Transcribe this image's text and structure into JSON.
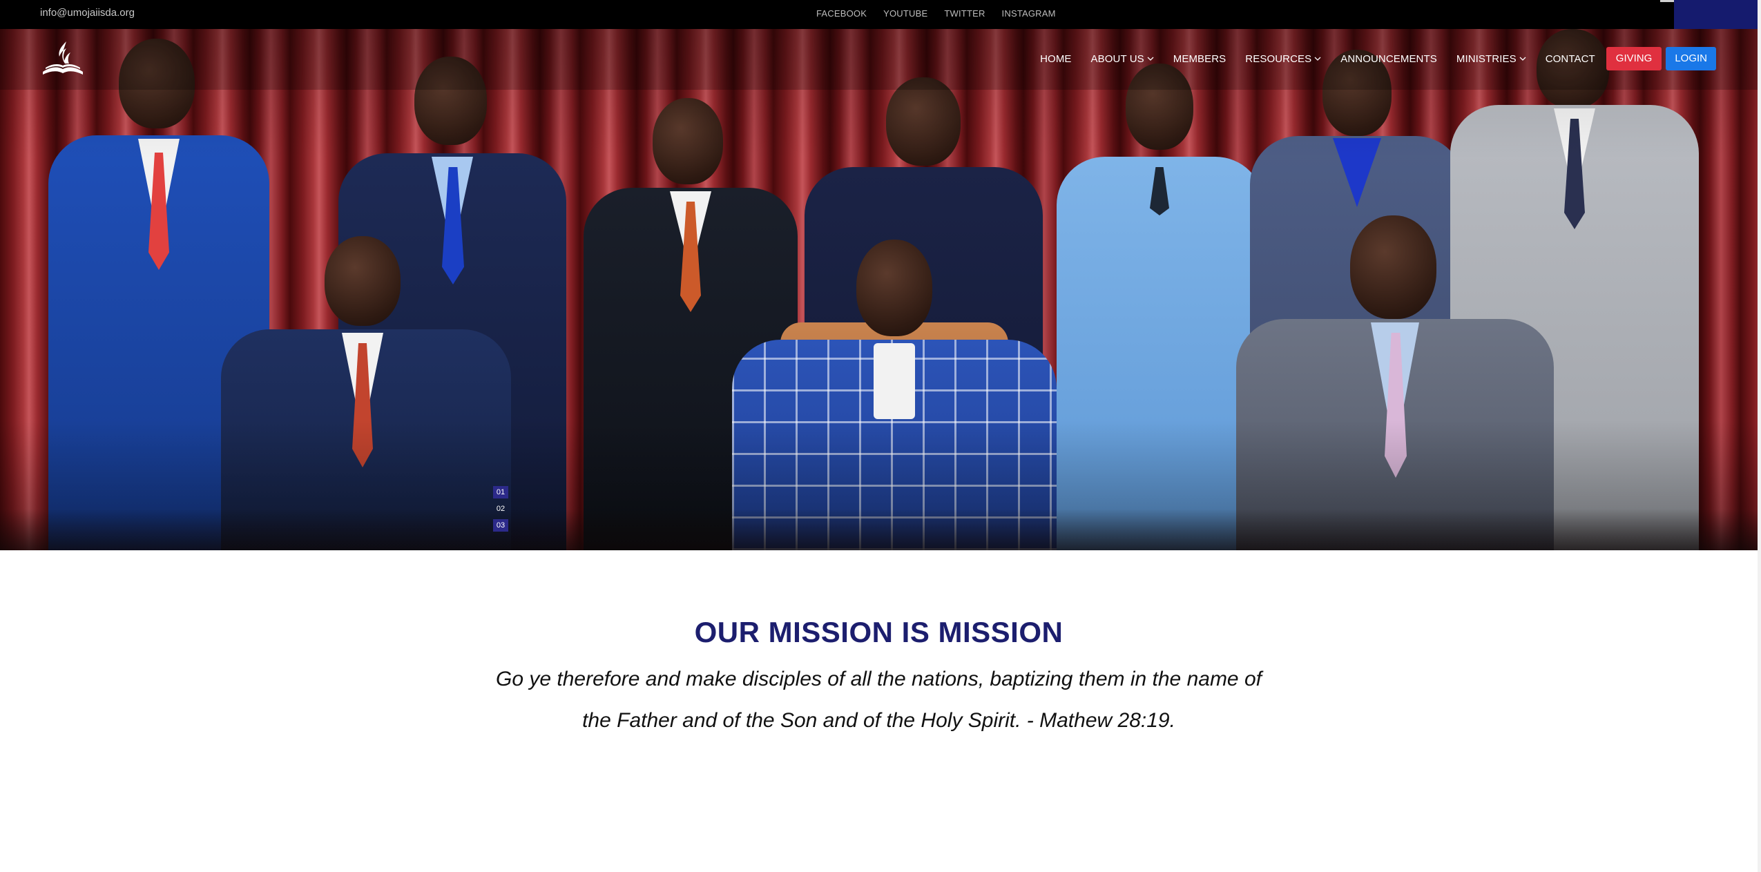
{
  "topbar": {
    "email": "info@umojaiisda.org",
    "social": [
      "FACEBOOK",
      "YOUTUBE",
      "TWITTER",
      "INSTAGRAM"
    ]
  },
  "nav": {
    "logo_icon": "adventist-flame-bible-logo",
    "items": [
      {
        "label": "HOME",
        "dropdown": false
      },
      {
        "label": "ABOUT US",
        "dropdown": true
      },
      {
        "label": "MEMBERS",
        "dropdown": false
      },
      {
        "label": "RESOURCES",
        "dropdown": true
      },
      {
        "label": "ANNOUNCEMENTS",
        "dropdown": false
      },
      {
        "label": "MINISTRIES",
        "dropdown": true
      },
      {
        "label": "CONTACT",
        "dropdown": false
      }
    ],
    "giving_label": "GIVING",
    "login_label": "LOGIN"
  },
  "hero": {
    "slides": [
      "01",
      "02",
      "03"
    ],
    "active_slide": "01"
  },
  "mission": {
    "title": "OUR MISSION IS MISSION",
    "line1": "Go ye therefore and make disciples of all the nations, baptizing them in the name of",
    "line2": "the Father and of the Son and of the Holy Spirit. - Mathew 28:19."
  },
  "colors": {
    "accent_navy": "#1c1e6e",
    "giving_red": "#e0303f",
    "login_blue": "#1a78e8",
    "curtain_red": "#8e2328"
  }
}
